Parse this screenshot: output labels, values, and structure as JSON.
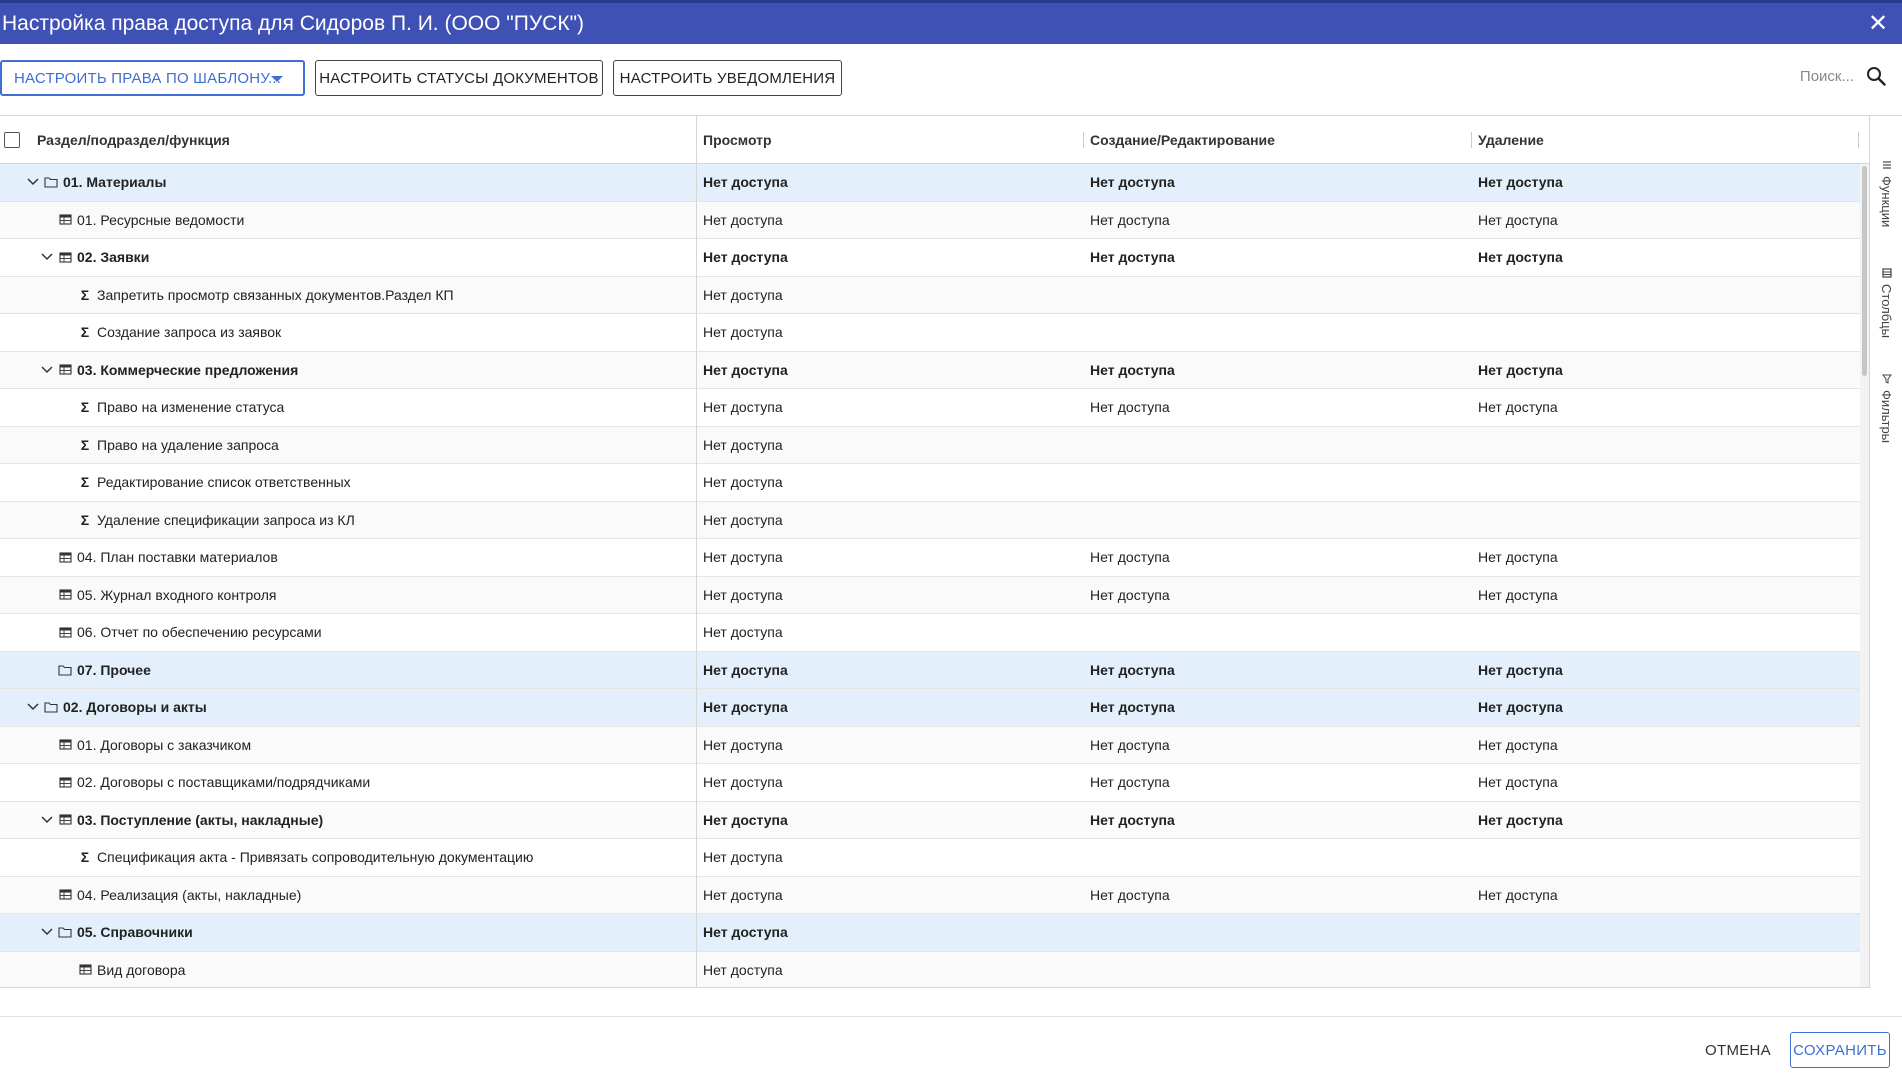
{
  "window": {
    "title": "Настройка права доступа для Сидоров П. И. (ООО \"ПУСК\")",
    "close_label": "✕"
  },
  "toolbar": {
    "template_button": "НАСТРОИТЬ ПРАВА ПО ШАБЛОНУ...",
    "statuses_button": "НАСТРОИТЬ СТАТУСЫ ДОКУМЕНТОВ",
    "notifications_button": "НАСТРОИТЬ УВЕДОМЛЕНИЯ",
    "search_placeholder": "Поиск..."
  },
  "grid": {
    "columns": [
      "Раздел/подраздел/функция",
      "Просмотр",
      "Создание/Редактирование",
      "Удаление"
    ],
    "rows": [
      {
        "level": 0,
        "expand": "down",
        "icon": "folder",
        "name": "01. Материалы",
        "view": "Нет доступа",
        "edit": "Нет доступа",
        "del": "Нет доступа",
        "bold": true,
        "hl": true
      },
      {
        "level": 1,
        "expand": "",
        "icon": "table",
        "name": "01. Ресурсные ведомости",
        "view": "Нет доступа",
        "edit": "Нет доступа",
        "del": "Нет доступа",
        "bold": false,
        "hl": false
      },
      {
        "level": 1,
        "expand": "down",
        "icon": "table",
        "name": "02. Заявки",
        "view": "Нет доступа",
        "edit": "Нет доступа",
        "del": "Нет доступа",
        "bold": true,
        "hl": false
      },
      {
        "level": 2,
        "expand": "",
        "icon": "sigma",
        "name": "Запретить просмотр связанных документов.Раздел КП",
        "view": "Нет доступа",
        "edit": "",
        "del": "",
        "bold": false,
        "hl": false
      },
      {
        "level": 2,
        "expand": "",
        "icon": "sigma",
        "name": "Создание запроса из заявок",
        "view": "Нет доступа",
        "edit": "",
        "del": "",
        "bold": false,
        "hl": false
      },
      {
        "level": 1,
        "expand": "down",
        "icon": "table",
        "name": "03. Коммерческие предложения",
        "view": "Нет доступа",
        "edit": "Нет доступа",
        "del": "Нет доступа",
        "bold": true,
        "hl": false
      },
      {
        "level": 2,
        "expand": "",
        "icon": "sigma",
        "name": "Право на изменение статуса",
        "view": "Нет доступа",
        "edit": "Нет доступа",
        "del": "Нет доступа",
        "bold": false,
        "hl": false
      },
      {
        "level": 2,
        "expand": "",
        "icon": "sigma",
        "name": "Право на удаление запроса",
        "view": "Нет доступа",
        "edit": "",
        "del": "",
        "bold": false,
        "hl": false
      },
      {
        "level": 2,
        "expand": "",
        "icon": "sigma",
        "name": "Редактирование список ответственных",
        "view": "Нет доступа",
        "edit": "",
        "del": "",
        "bold": false,
        "hl": false
      },
      {
        "level": 2,
        "expand": "",
        "icon": "sigma",
        "name": "Удаление спецификации запроса из КЛ",
        "view": "Нет доступа",
        "edit": "",
        "del": "",
        "bold": false,
        "hl": false
      },
      {
        "level": 1,
        "expand": "",
        "icon": "table",
        "name": "04. План поставки материалов",
        "view": "Нет доступа",
        "edit": "Нет доступа",
        "del": "Нет доступа",
        "bold": false,
        "hl": false
      },
      {
        "level": 1,
        "expand": "",
        "icon": "table",
        "name": "05. Журнал входного контроля",
        "view": "Нет доступа",
        "edit": "Нет доступа",
        "del": "Нет доступа",
        "bold": false,
        "hl": false
      },
      {
        "level": 1,
        "expand": "",
        "icon": "table",
        "name": "06. Отчет по обеспечению ресурсами",
        "view": "Нет доступа",
        "edit": "",
        "del": "",
        "bold": false,
        "hl": false
      },
      {
        "level": 1,
        "expand": "",
        "icon": "folder",
        "name": "07. Прочее",
        "view": "Нет доступа",
        "edit": "Нет доступа",
        "del": "Нет доступа",
        "bold": true,
        "hl": true
      },
      {
        "level": 0,
        "expand": "down",
        "icon": "folder",
        "name": "02. Договоры и акты",
        "view": "Нет доступа",
        "edit": "Нет доступа",
        "del": "Нет доступа",
        "bold": true,
        "hl": true
      },
      {
        "level": 1,
        "expand": "",
        "icon": "table",
        "name": "01. Договоры с заказчиком",
        "view": "Нет доступа",
        "edit": "Нет доступа",
        "del": "Нет доступа",
        "bold": false,
        "hl": false
      },
      {
        "level": 1,
        "expand": "",
        "icon": "table",
        "name": "02. Договоры с поставщиками/подрядчиками",
        "view": "Нет доступа",
        "edit": "Нет доступа",
        "del": "Нет доступа",
        "bold": false,
        "hl": false
      },
      {
        "level": 1,
        "expand": "down",
        "icon": "table",
        "name": "03. Поступление (акты, накладные)",
        "view": "Нет доступа",
        "edit": "Нет доступа",
        "del": "Нет доступа",
        "bold": true,
        "hl": false
      },
      {
        "level": 2,
        "expand": "",
        "icon": "sigma",
        "name": "Спецификация акта - Привязать сопроводительную документацию",
        "view": "Нет доступа",
        "edit": "",
        "del": "",
        "bold": false,
        "hl": false
      },
      {
        "level": 1,
        "expand": "",
        "icon": "table",
        "name": "04. Реализация (акты, накладные)",
        "view": "Нет доступа",
        "edit": "Нет доступа",
        "del": "Нет доступа",
        "bold": false,
        "hl": false
      },
      {
        "level": 1,
        "expand": "down",
        "icon": "folder",
        "name": "05. Справочники",
        "view": "Нет доступа",
        "edit": "",
        "del": "",
        "bold": true,
        "hl": true
      },
      {
        "level": 2,
        "expand": "",
        "icon": "table",
        "name": "Вид договора",
        "view": "Нет доступа",
        "edit": "",
        "del": "",
        "bold": false,
        "hl": false
      }
    ]
  },
  "side_panel": {
    "tabs": [
      {
        "label": "Функции",
        "icon": "menu-icon"
      },
      {
        "label": "Столбцы",
        "icon": "columns-icon"
      },
      {
        "label": "Фильтры",
        "icon": "filter-icon"
      }
    ]
  },
  "footer": {
    "cancel_label": "ОТМЕНА",
    "save_label": "СОХРАНИТЬ"
  },
  "colors": {
    "titlebar": "#3f51b5",
    "accent": "#3f6fd1",
    "row_highlight": "#e3f0fc"
  }
}
